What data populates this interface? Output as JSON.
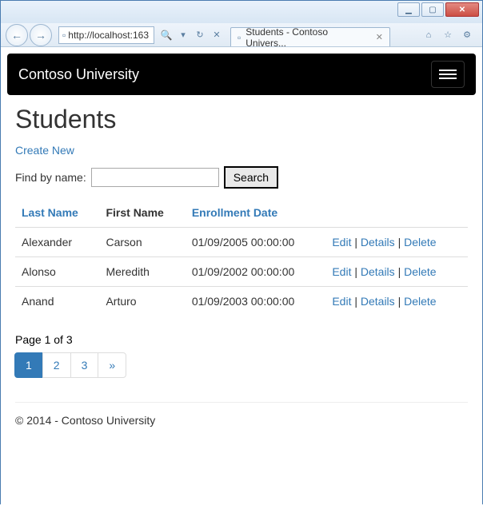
{
  "window": {
    "url": "http://localhost:163",
    "tab_title": "Students - Contoso Univers..."
  },
  "site": {
    "brand": "Contoso University",
    "footer": "© 2014 - Contoso University"
  },
  "page": {
    "heading": "Students",
    "create_link": "Create New",
    "search_label": "Find by name:",
    "search_value": "",
    "search_button": "Search"
  },
  "table": {
    "headers": {
      "last_name": "Last Name",
      "first_name": "First Name",
      "enrollment_date": "Enrollment Date"
    },
    "actions": {
      "edit": "Edit",
      "details": "Details",
      "delete": "Delete"
    },
    "rows": [
      {
        "last": "Alexander",
        "first": "Carson",
        "date": "01/09/2005 00:00:00"
      },
      {
        "last": "Alonso",
        "first": "Meredith",
        "date": "01/09/2002 00:00:00"
      },
      {
        "last": "Anand",
        "first": "Arturo",
        "date": "01/09/2003 00:00:00"
      }
    ]
  },
  "pager": {
    "info": "Page 1 of 3",
    "pages": [
      "1",
      "2",
      "3"
    ],
    "next": "»",
    "current": "1"
  }
}
